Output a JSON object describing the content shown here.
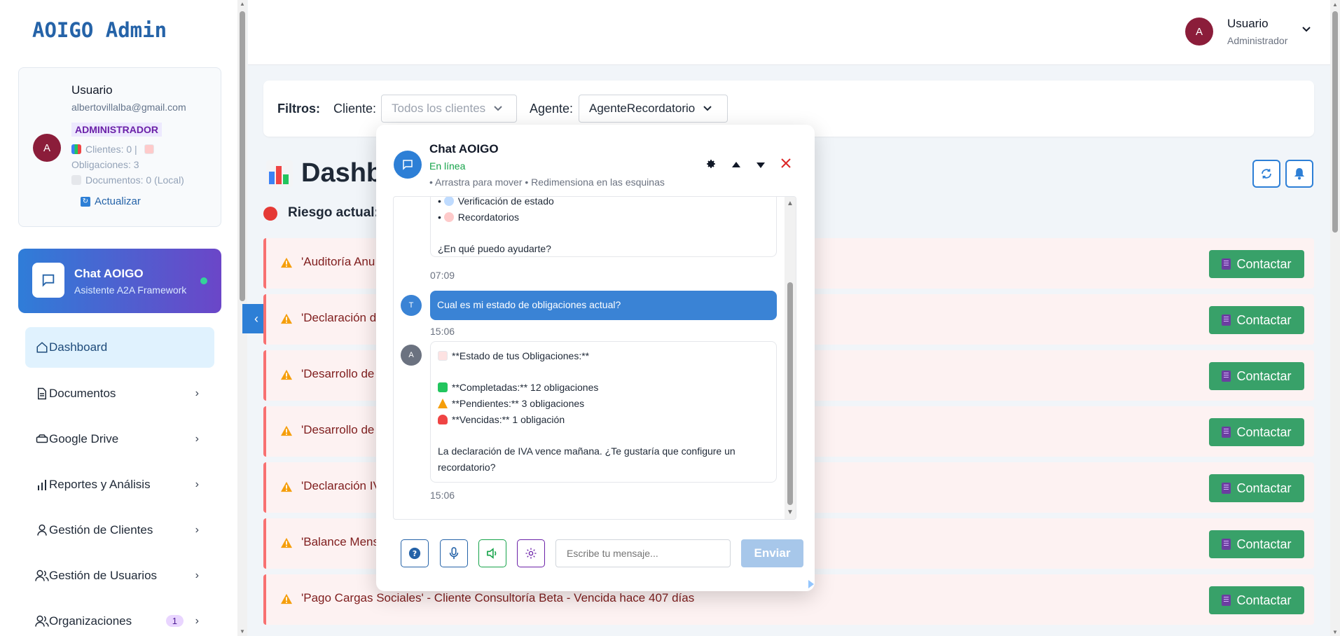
{
  "sidebar": {
    "logo": "AOIGO Admin",
    "user": {
      "avatar_letter": "A",
      "name": "Usuario",
      "email": "albertovillalba@gmail.com",
      "role": "ADMINISTRADOR",
      "stats_clients": "Clientes: 0 |",
      "stats_obligations": "Obligaciones: 3",
      "stats_documents": "Documentos: 0 (Local)",
      "refresh_label": "Actualizar"
    },
    "chat_card": {
      "title": "Chat AOIGO",
      "subtitle": "Asistente A2A Framework"
    },
    "nav": [
      {
        "label": "Dashboard"
      },
      {
        "label": "Documentos"
      },
      {
        "label": "Google Drive"
      },
      {
        "label": "Reportes y Análisis"
      },
      {
        "label": "Gestión de Clientes"
      },
      {
        "label": "Gestión de Usuarios"
      },
      {
        "label": "Organizaciones",
        "badge": "1"
      }
    ]
  },
  "header": {
    "avatar_letter": "A",
    "user_name": "Usuario",
    "user_role": "Administrador"
  },
  "filters": {
    "label": "Filtros:",
    "client_label": "Cliente:",
    "client_placeholder": "Todos los clientes",
    "agent_label": "Agente:",
    "agent_value": "AgenteRecordatorio"
  },
  "dashboard": {
    "title": "Dashb",
    "risk_label": "Riesgo actual:",
    "contact_label": "Contactar",
    "alerts": [
      "'Auditoría Anu",
      "'Declaración de",
      "'Desarrollo de",
      "'Desarrollo de",
      "'Declaración IV",
      "'Balance Mensu",
      "'Pago Cargas Sociales' - Cliente Consultoría Beta - Vencida hace 407 días"
    ]
  },
  "chat": {
    "title": "Chat AOIGO",
    "status": "En línea",
    "hint": "• Arrastra para mover • Redimensiona en las esquinas",
    "bot_msg1": {
      "line1": "Verificación de estado",
      "line2": "Recordatorios",
      "line3": "¿En qué puedo ayudarte?",
      "time": "07:09"
    },
    "user_msg": {
      "avatar": "T",
      "text": "Cual es mi estado de obligaciones actual?",
      "time": "15:06"
    },
    "bot_msg2": {
      "avatar": "A",
      "l1": "**Estado de tus Obligaciones:**",
      "l2": "**Completadas:** 12 obligaciones",
      "l3": "**Pendientes:** 3 obligaciones",
      "l4": "**Vencidas:** 1 obligación",
      "l5": "La declaración de IVA vence mañana. ¿Te gustaría que configure un",
      "l6": "recordatorio?",
      "time": "15:06"
    },
    "input_placeholder": "Escribe tu mensaje...",
    "send_label": "Enviar"
  },
  "colors": {
    "primary": "#2d7fd6",
    "success": "#38a169",
    "danger": "#e53935",
    "avatar": "#8b1d3a"
  }
}
